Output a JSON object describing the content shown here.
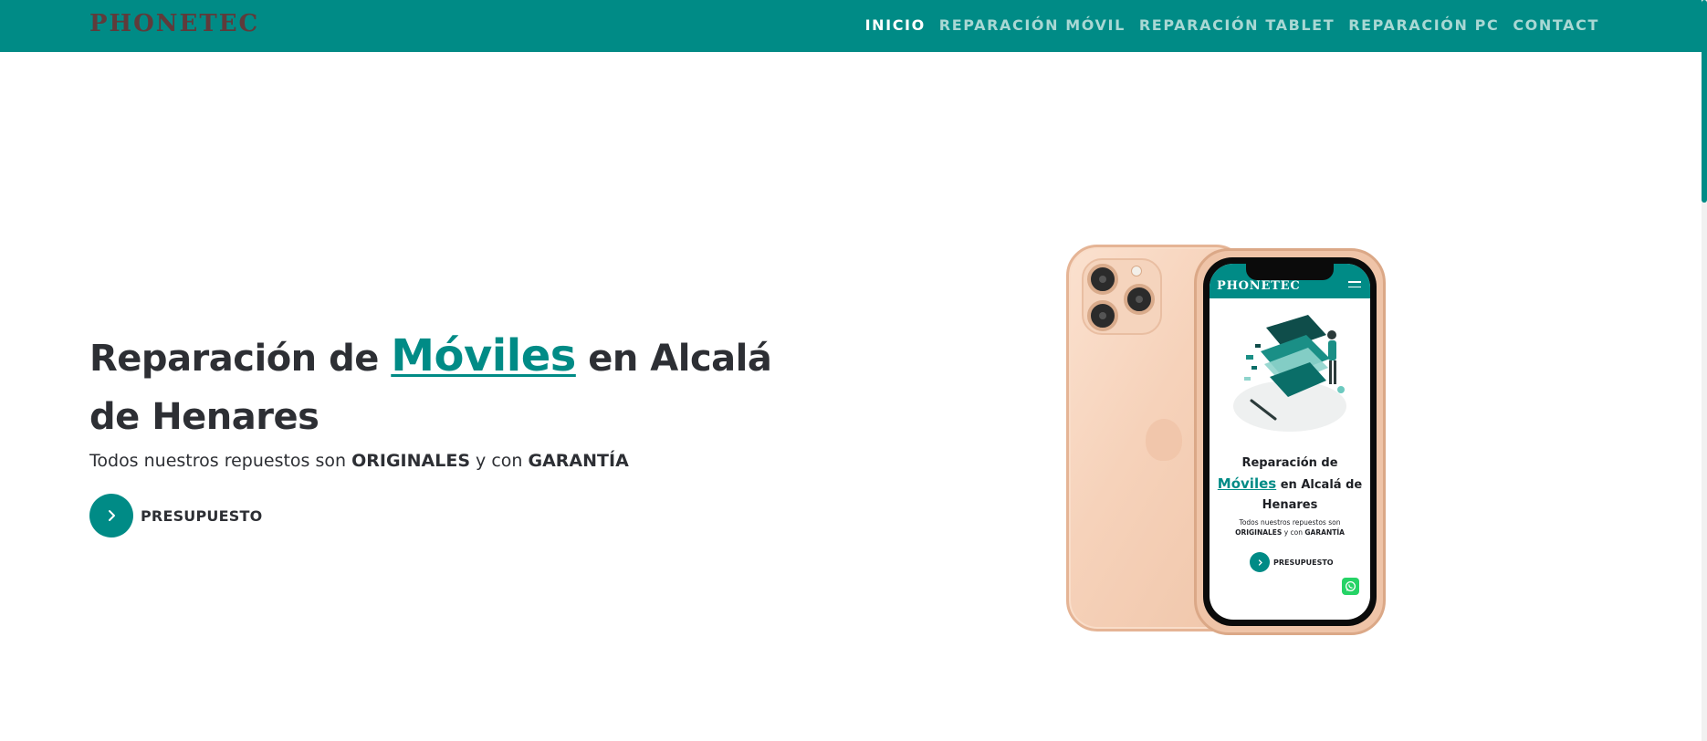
{
  "brand": {
    "logo": "PHONETEC",
    "accent_color": "#008b86"
  },
  "nav": {
    "items": [
      {
        "label": "INICIO",
        "active": true
      },
      {
        "label": "REPARACIÓN MÓVIL",
        "active": false
      },
      {
        "label": "REPARACIÓN TABLET",
        "active": false
      },
      {
        "label": "REPARACIÓN PC",
        "active": false
      },
      {
        "label": "CONTACT",
        "active": false
      }
    ]
  },
  "hero": {
    "title_before": "Reparación de ",
    "title_highlight": "Móviles",
    "title_after": " en Alcalá de Henares",
    "subtitle_prefix": "Todos nuestros repuestos son ",
    "subtitle_bold_1": "ORIGINALES",
    "subtitle_middle": " y con ",
    "subtitle_bold_2": "GARANTÍA",
    "cta_label": "PRESUPUESTO",
    "cta_icon": "chevron-right-icon"
  },
  "mockup": {
    "screen_logo": "PHONETEC",
    "screen_title_before": "Reparación de",
    "screen_title_highlight": "Móviles",
    "screen_title_after": " en Alcalá de Henares",
    "screen_sub_prefix": "Todos nuestros repuestos son ",
    "screen_sub_bold_1": "ORIGINALES",
    "screen_sub_middle": " y con ",
    "screen_sub_bold_2": "GARANTÍA",
    "screen_cta_label": "PRESUPUESTO",
    "whatsapp_icon": "whatsapp-icon",
    "menu_icon": "hamburger-menu-icon"
  }
}
